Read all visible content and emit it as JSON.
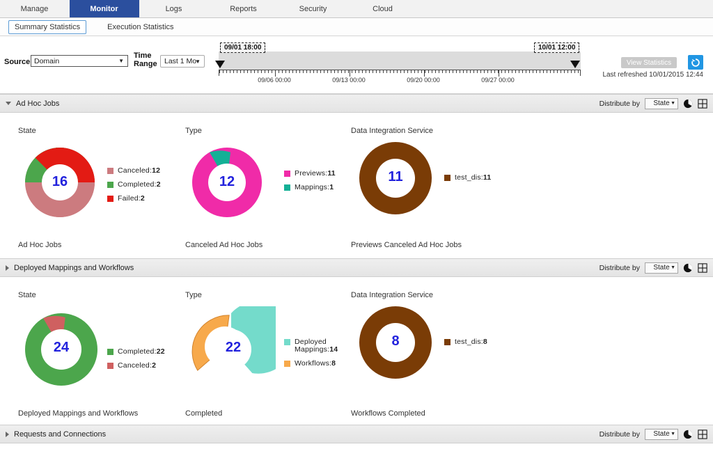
{
  "nav": {
    "tabs": [
      {
        "label": "Manage",
        "active": false
      },
      {
        "label": "Monitor",
        "active": true
      },
      {
        "label": "Logs",
        "active": false
      },
      {
        "label": "Reports",
        "active": false
      },
      {
        "label": "Security",
        "active": false
      },
      {
        "label": "Cloud",
        "active": false
      }
    ],
    "subtabs": [
      {
        "label": "Summary Statistics",
        "selected": true
      },
      {
        "label": "Execution Statistics",
        "selected": false
      }
    ]
  },
  "toolbar": {
    "source_label": "Source",
    "source_value": "Domain",
    "time_range_label_line1": "Time",
    "time_range_label_line2": "Range",
    "time_range_value": "Last 1 Mo",
    "view_statistics_label": "View Statistics",
    "refresh_icon": "refresh-icon",
    "last_refreshed": "Last refreshed 10/01/2015 12:44",
    "timeline": {
      "start_flag": "09/01 18:00",
      "end_flag": "10/01 12:00",
      "tick_labels": [
        "09/06 00:00",
        "09/13 00:00",
        "09/20 00:00",
        "09/27 00:00"
      ]
    }
  },
  "distribute": {
    "label": "Distribute by",
    "value": "State",
    "pie_icon": "pie-chart-icon",
    "grid_icon": "grid-view-icon"
  },
  "sections": [
    {
      "title": "Ad Hoc Jobs",
      "expanded": true,
      "charts": [
        {
          "column_title": "State",
          "footer": "Ad Hoc Jobs",
          "total": "16",
          "legend": [
            {
              "label": "Canceled:",
              "value": "12",
              "color": "#cc7b7f"
            },
            {
              "label": "Completed:",
              "value": "2",
              "color": "#4ca64c"
            },
            {
              "label": "Failed:",
              "value": "2",
              "color": "#e31b14"
            }
          ]
        },
        {
          "column_title": "Type",
          "footer": "Canceled Ad Hoc Jobs",
          "total": "12",
          "legend": [
            {
              "label": "Previews:",
              "value": "11",
              "color": "#f02ba8"
            },
            {
              "label": "Mappings:",
              "value": "1",
              "color": "#14b096"
            }
          ]
        },
        {
          "column_title": "Data Integration Service",
          "footer": "Previews Canceled Ad Hoc Jobs",
          "total": "11",
          "legend": [
            {
              "label": "test_dis:",
              "value": "11",
              "color": "#7a3c06"
            }
          ]
        }
      ]
    },
    {
      "title": "Deployed Mappings and Workflows",
      "expanded": false,
      "charts": [
        {
          "column_title": "State",
          "footer": "Deployed Mappings and Workflows",
          "total": "24",
          "legend": [
            {
              "label": "Completed:",
              "value": "22",
              "color": "#4ca64c"
            },
            {
              "label": "Canceled:",
              "value": "2",
              "color": "#cf6060"
            }
          ]
        },
        {
          "column_title": "Type",
          "footer": "Completed",
          "total": "22",
          "legend": [
            {
              "label": "Deployed Mappings:",
              "value": "14",
              "color": "#74dbcb"
            },
            {
              "label": "Workflows:",
              "value": "8",
              "color": "#f7a94b"
            }
          ]
        },
        {
          "column_title": "Data Integration Service",
          "footer": "Workflows Completed",
          "total": "8",
          "legend": [
            {
              "label": "test_dis:",
              "value": "8",
              "color": "#7a3c06"
            }
          ]
        }
      ]
    },
    {
      "title": "Requests and Connections",
      "expanded": false,
      "charts": []
    }
  ],
  "chart_data": [
    {
      "type": "pie",
      "title": "Ad Hoc Jobs - State",
      "center_label": "16",
      "labels": [
        "Canceled",
        "Completed",
        "Failed"
      ],
      "values": [
        12,
        2,
        2
      ],
      "colors": [
        "#cc7b7f",
        "#4ca64c",
        "#e31b14"
      ],
      "legend_position": "right",
      "donut": true
    },
    {
      "type": "pie",
      "title": "Canceled Ad Hoc Jobs - Type",
      "center_label": "12",
      "labels": [
        "Previews",
        "Mappings"
      ],
      "values": [
        11,
        1
      ],
      "colors": [
        "#f02ba8",
        "#14b096"
      ],
      "legend_position": "right",
      "donut": true
    },
    {
      "type": "pie",
      "title": "Previews Canceled Ad Hoc Jobs - Data Integration Service",
      "center_label": "11",
      "labels": [
        "test_dis"
      ],
      "values": [
        11
      ],
      "colors": [
        "#7a3c06"
      ],
      "legend_position": "right",
      "donut": true
    },
    {
      "type": "pie",
      "title": "Deployed Mappings and Workflows - State",
      "center_label": "24",
      "labels": [
        "Completed",
        "Canceled"
      ],
      "values": [
        22,
        2
      ],
      "colors": [
        "#4ca64c",
        "#cf6060"
      ],
      "legend_position": "right",
      "donut": true
    },
    {
      "type": "pie",
      "title": "Completed - Type",
      "center_label": "22",
      "labels": [
        "Deployed Mappings",
        "Workflows"
      ],
      "values": [
        14,
        8
      ],
      "colors": [
        "#74dbcb",
        "#f7a94b"
      ],
      "exploded": [
        "Workflows"
      ],
      "legend_position": "right",
      "donut": true
    },
    {
      "type": "pie",
      "title": "Workflows Completed - Data Integration Service",
      "center_label": "8",
      "labels": [
        "test_dis"
      ],
      "values": [
        8
      ],
      "colors": [
        "#7a3c06"
      ],
      "legend_position": "right",
      "donut": true
    }
  ]
}
